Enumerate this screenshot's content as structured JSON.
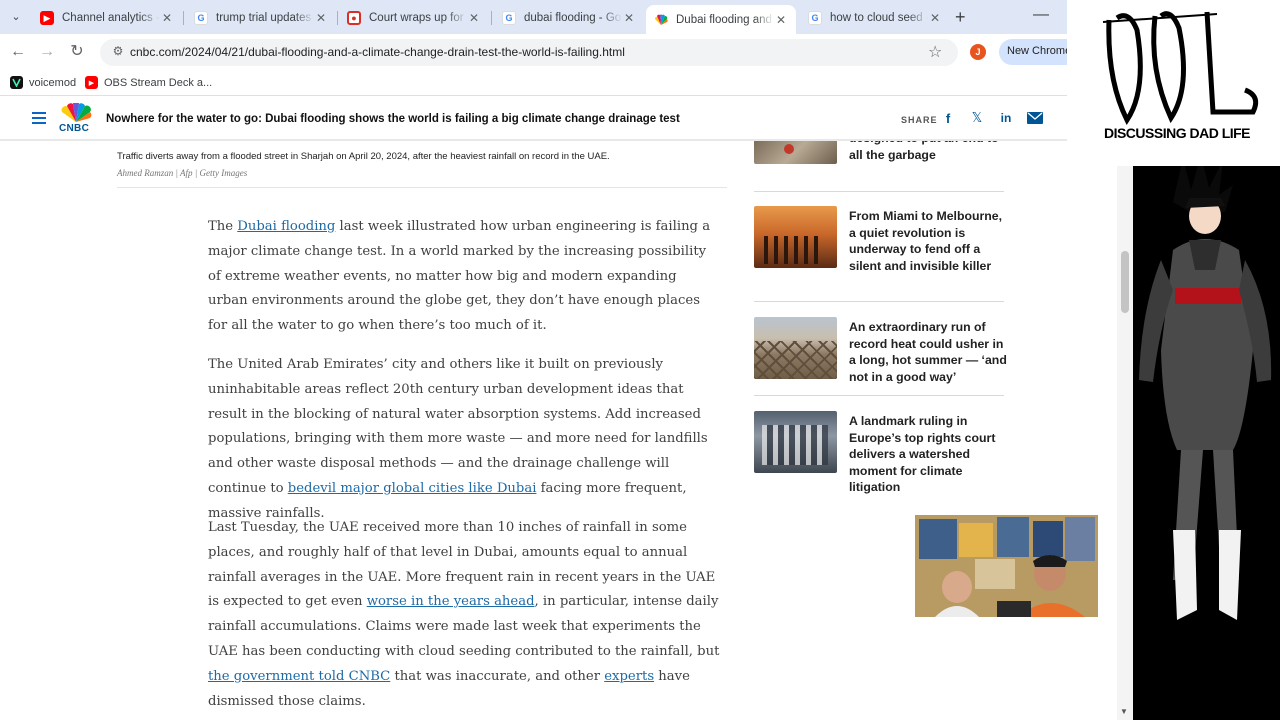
{
  "browser": {
    "tabs": [
      {
        "title": "Channel analytics - Yo",
        "favicon": "youtube-icon"
      },
      {
        "title": "trump trial updates - G",
        "favicon": "google-icon"
      },
      {
        "title": "Court wraps up for the",
        "favicon": "news-icon"
      },
      {
        "title": "dubai flooding - Goo",
        "favicon": "google-icon"
      },
      {
        "title": "Dubai flooding and a c",
        "favicon": "nbc-peacock-icon",
        "active": true
      },
      {
        "title": "how to cloud seed - G",
        "favicon": "google-icon"
      }
    ],
    "url": "cnbc.com/2024/04/21/dubai-flooding-and-a-climate-change-drain-test-the-world-is-failing.html",
    "profile_initial": "J",
    "new_chrome_label": "New Chrome",
    "bookmarks": [
      {
        "label": "voicemod"
      },
      {
        "label": "OBS Stream Deck a..."
      }
    ]
  },
  "header": {
    "logo_text": "CNBC",
    "headline": "Nowhere for the water to go: Dubai flooding shows the world is failing a big climate change drainage test",
    "share_label": "SHARE"
  },
  "article": {
    "caption": "Traffic diverts away from a flooded street in Sharjah on April 20, 2024, after the heaviest rainfall on record in the UAE.",
    "credit": "Ahmed Ramzan | Afp | Getty Images",
    "p1": {
      "pre": "The ",
      "link": "Dubai flooding",
      "post": " last week illustrated how urban engineering is failing a major climate change test. In a world marked by the increasing possibility of extreme weather events, no matter how big and modern expanding urban environments around the globe get, they don’t have enough places for all the water to go when there’s too much of it."
    },
    "p2": {
      "pre": "The United Arab Emirates’ city and others like it built on previously uninhabitable areas reflect 20th century urban development ideas that result in the blocking of natural water absorption systems. Add increased populations, bringing with them more waste — and more need for landfills and other waste disposal methods — and the drainage challenge will continue to ",
      "link": "bedevil major global cities like Dubai",
      "post": " facing more frequent, massive rainfalls."
    },
    "p3": {
      "pre": "Last Tuesday, the UAE received more than 10 inches of rainfall in some places, and roughly half of that level in Dubai, amounts equal to annual rainfall averages in the UAE. More frequent rain in recent years in the UAE is expected to get even ",
      "link1": "worse in the years ahead",
      "mid": ", in particular, intense daily rainfall accumulations. Claims were made last week that experiments the UAE has been conducting with cloud seeding contributed to the rainfall, but ",
      "link2": "the government told CNBC",
      "mid2": " that was inaccurate, and other ",
      "link3": "experts",
      "post": " have dismissed those claims."
    }
  },
  "sidebar": {
    "stories": [
      {
        "title": "designed to put an end to all the garbage"
      },
      {
        "title": "From Miami to Melbourne, a quiet revolution is underway to fend off a silent and invisible killer"
      },
      {
        "title": "An extraordinary run of record heat could usher in a long, hot summer — ‘and not in a good way’"
      },
      {
        "title": "A landmark ruling in Europe’s top rights court delivers a watershed moment for climate litigation"
      }
    ]
  },
  "overlay": {
    "brand_text": "DISCUSSING DAD LIFE"
  },
  "colors": {
    "link": "#1d6aa7",
    "cnbc_blue": "#005594",
    "tabstrip": "#dfe7f6"
  }
}
